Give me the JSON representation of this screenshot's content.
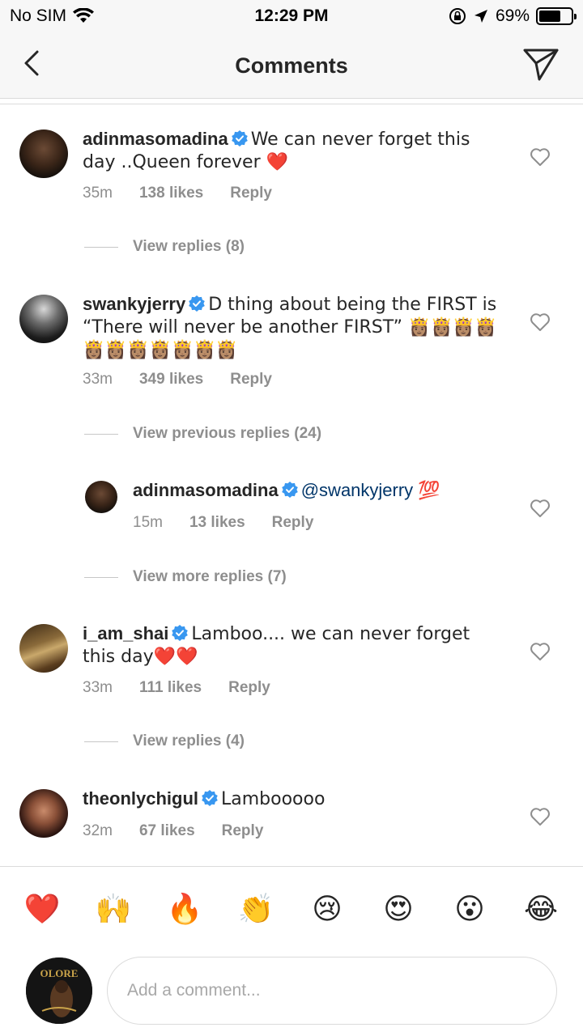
{
  "status_bar": {
    "carrier": "No SIM",
    "time": "12:29 PM",
    "battery": "69%",
    "battery_level": 0.69,
    "icons": [
      "wifi-icon",
      "orientation-lock-icon",
      "location-arrow-icon",
      "battery-icon"
    ]
  },
  "nav": {
    "title": "Comments",
    "back_icon": "chevron-left-icon",
    "share_icon": "paper-plane-icon"
  },
  "comments": [
    {
      "username": "adinmasomadina",
      "text": "We can never forget this day ..Queen forever ❤️",
      "time": "35m",
      "likes": "138 likes",
      "reply": "Reply",
      "view_replies": "View replies (8)"
    },
    {
      "username": "swankyjerry",
      "text": "D thing about being the FIRST is “There will never be another FIRST” 👸🏽👸🏽👸🏽👸🏽👸🏽👸🏽👸🏽👸🏽👸🏽👸🏽👸🏽",
      "time": "33m",
      "likes": "349 likes",
      "reply": "Reply",
      "view_previous": "View previous replies (24)",
      "replies": [
        {
          "username": "adinmasomadina",
          "mention": "@swankyjerry",
          "text": "💯",
          "time": "15m",
          "likes": "13 likes",
          "reply": "Reply"
        }
      ],
      "view_more": "View more replies (7)"
    },
    {
      "username": "i_am_shai",
      "text": "Lamboo.... we can never forget this day❤️❤️",
      "time": "33m",
      "likes": "111 likes",
      "reply": "Reply",
      "view_replies": "View replies (4)"
    },
    {
      "username": "theonlychigul",
      "text": "Lambooooo",
      "time": "32m",
      "likes": "67 likes",
      "reply": "Reply"
    }
  ],
  "emoji_bar": [
    "❤️",
    "🙌",
    "🔥",
    "👏",
    "😢",
    "😍",
    "😮",
    "😂"
  ],
  "compose": {
    "placeholder": "Add a comment...",
    "avatar_text": "OLORE"
  },
  "colors": {
    "verified": "#3897f0",
    "meta": "#8e8e8e",
    "text": "#262626",
    "mention": "#003569"
  }
}
